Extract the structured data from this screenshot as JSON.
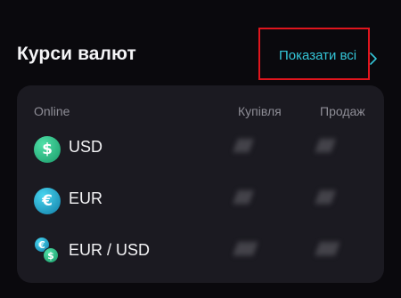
{
  "header": {
    "title": "Курси валют",
    "show_all_label": "Показати всі"
  },
  "table": {
    "columns": {
      "online": "Online",
      "buy": "Купівля",
      "sell": "Продаж"
    },
    "rows": [
      {
        "code": "USD",
        "icon": "usd-coin-icon",
        "buy": "////",
        "sell": "////"
      },
      {
        "code": "EUR",
        "icon": "eur-coin-icon",
        "buy": "////",
        "sell": "////"
      },
      {
        "code": "EUR / USD",
        "icon": "eur-usd-coin-icon",
        "buy": "/////",
        "sell": "/////"
      }
    ]
  },
  "colors": {
    "background": "#0a090d",
    "card": "#1b1a21",
    "accent": "#34c6d8",
    "highlight": "#e0151d"
  }
}
